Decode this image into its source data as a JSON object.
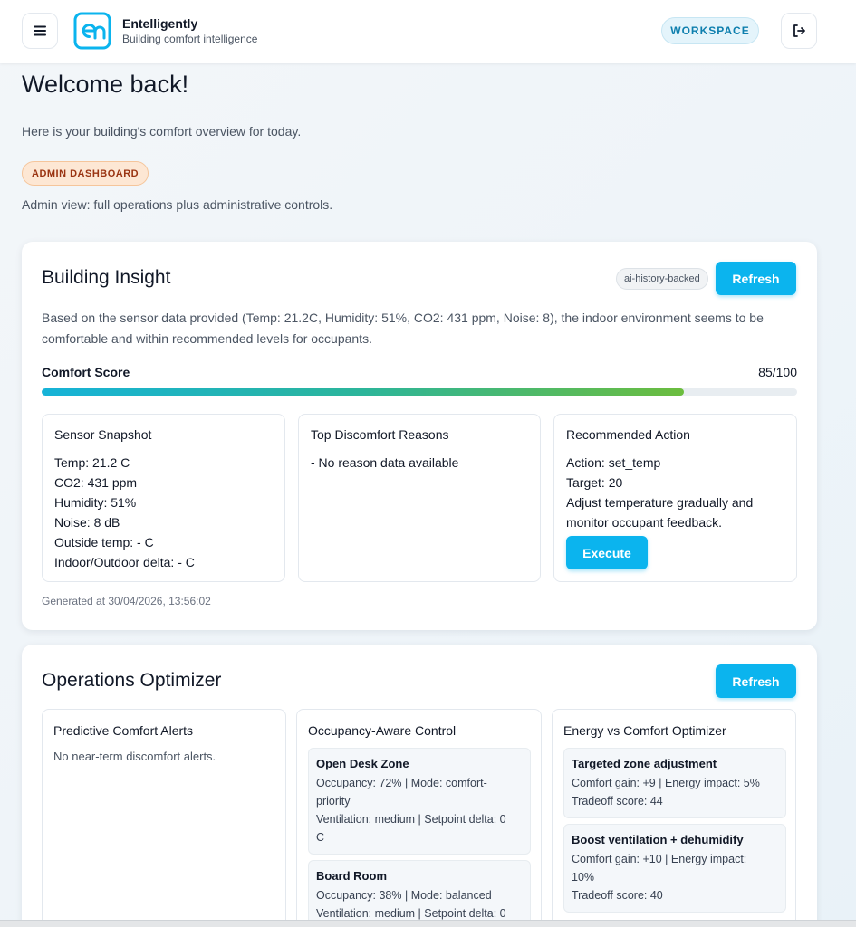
{
  "header": {
    "brand_name": "Entelligently",
    "brand_tagline": "Building comfort intelligence",
    "workspace_label": "WORKSPACE",
    "menu_icon": "hamburger-menu-icon",
    "logout_icon": "logout-icon",
    "brand_color": "#0bb4ee"
  },
  "welcome": {
    "title": "Welcome back!",
    "subtitle": "Here is your building's comfort overview for today.",
    "role_badge": "ADMIN DASHBOARD",
    "role_note": "Admin view: full operations plus administrative controls."
  },
  "insight": {
    "title": "Building Insight",
    "tag": "ai-history-backed",
    "refresh_label": "Refresh",
    "summary": "Based on the sensor data provided (Temp: 21.2C, Humidity: 51%, CO2: 431 ppm, Noise: 8), the indoor environment seems to be comfortable and within recommended levels for occupants.",
    "comfort_label": "Comfort Score",
    "comfort_value_text": "85/100",
    "comfort_fraction": 0.85,
    "sensor": {
      "title": "Sensor Snapshot",
      "lines": [
        "Temp: 21.2 C",
        "CO2: 431 ppm",
        "Humidity: 51%",
        "Noise: 8 dB",
        "Outside temp: - C",
        "Indoor/Outdoor delta: - C"
      ]
    },
    "discomfort": {
      "title": "Top Discomfort Reasons",
      "lines": [
        "- No reason data available"
      ]
    },
    "action": {
      "title": "Recommended Action",
      "lines": [
        "Action: set_temp",
        "Target: 20",
        "Adjust temperature gradually and",
        "monitor occupant feedback."
      ],
      "execute_label": "Execute"
    },
    "generated": "Generated at 30/04/2026, 13:56:02"
  },
  "ops": {
    "title": "Operations Optimizer",
    "refresh_label": "Refresh",
    "alerts": {
      "title": "Predictive Comfort Alerts",
      "empty": "No near-term discomfort alerts."
    },
    "occupancy": {
      "title": "Occupancy-Aware Control",
      "zones": [
        {
          "name": "Open Desk Zone",
          "lines": [
            "Occupancy: 72% | Mode: comfort-",
            "priority",
            "Ventilation: medium | Setpoint delta: 0",
            "C"
          ]
        },
        {
          "name": "Board Room",
          "lines": [
            "Occupancy: 38% | Mode: balanced",
            "Ventilation: medium | Setpoint delta: 0"
          ]
        }
      ]
    },
    "energy": {
      "title": "Energy vs Comfort Optimizer",
      "options": [
        {
          "name": "Targeted zone adjustment",
          "lines": [
            "Comfort gain: +9 | Energy impact: 5%",
            "Tradeoff score: 44"
          ]
        },
        {
          "name": "Boost ventilation + dehumidify",
          "lines": [
            "Comfort gain: +10 | Energy impact:",
            "10%",
            "Tradeoff score: 40"
          ]
        }
      ]
    }
  }
}
